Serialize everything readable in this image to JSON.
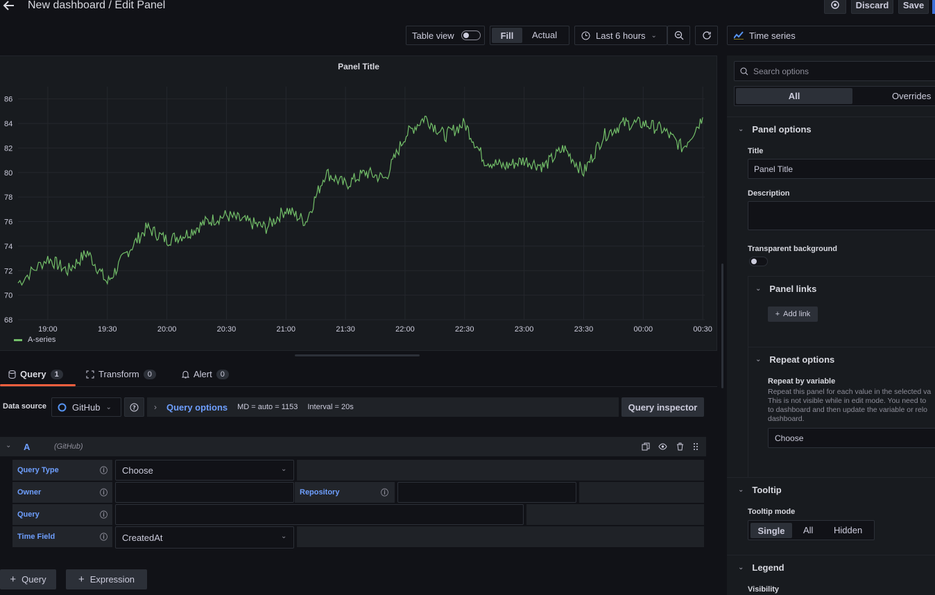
{
  "header": {
    "title": "New dashboard / Edit Panel",
    "discard": "Discard",
    "save": "Save"
  },
  "toolbar": {
    "table_view": "Table view",
    "fill": "Fill",
    "actual": "Actual",
    "time_range": "Last 6 hours",
    "viz_type": "Time series"
  },
  "panel": {
    "title": "Panel Title",
    "chart_data": {
      "type": "line",
      "title": "Panel Title",
      "x_ticks": [
        "19:00",
        "19:30",
        "20:00",
        "20:30",
        "21:00",
        "21:30",
        "22:00",
        "22:30",
        "23:00",
        "23:30",
        "00:00",
        "00:30"
      ],
      "y_ticks": [
        "68",
        "70",
        "72",
        "74",
        "76",
        "78",
        "80",
        "82",
        "84",
        "86"
      ],
      "ylim": [
        68,
        87
      ],
      "series": [
        {
          "name": "A-series",
          "color": "#73bf69",
          "x": [
            "18:45",
            "19:00",
            "19:10",
            "19:20",
            "19:30",
            "19:40",
            "19:50",
            "20:00",
            "20:10",
            "20:20",
            "20:30",
            "20:40",
            "20:50",
            "21:00",
            "21:10",
            "21:20",
            "21:30",
            "21:40",
            "21:50",
            "22:00",
            "22:10",
            "22:20",
            "22:30",
            "22:40",
            "22:50",
            "23:00",
            "23:10",
            "23:20",
            "23:30",
            "23:40",
            "23:50",
            "00:00",
            "00:10",
            "00:20",
            "00:30"
          ],
          "values": [
            71,
            73,
            72,
            73.5,
            71,
            73.5,
            75.5,
            74.5,
            75,
            76,
            76.5,
            76,
            75.5,
            77,
            76,
            80,
            79,
            80,
            79.5,
            83,
            84.5,
            83,
            84,
            81,
            80.5,
            81,
            80.5,
            82,
            80,
            83,
            84,
            84,
            83.5,
            82,
            84.5
          ]
        }
      ]
    }
  },
  "query_tabs": [
    {
      "label": "Query",
      "count": "1"
    },
    {
      "label": "Transform",
      "count": "0"
    },
    {
      "label": "Alert",
      "count": "0"
    }
  ],
  "query": {
    "datasource_label": "Data source",
    "datasource": "GitHub",
    "options_label": "Query options",
    "md": "MD = auto = 1153",
    "interval": "Interval = 20s",
    "inspector": "Query inspector",
    "row_letter": "A",
    "row_ds": "(GitHub)",
    "fields": {
      "query_type": "Query Type",
      "query_type_value": "Choose",
      "owner": "Owner",
      "repository": "Repository",
      "query": "Query",
      "time_field": "Time Field",
      "time_field_value": "CreatedAt"
    },
    "add_query": "Query",
    "add_expression": "Expression"
  },
  "options": {
    "search_placeholder": "Search options",
    "tab_all": "All",
    "tab_overrides": "Overrides",
    "panel_options": "Panel options",
    "title_label": "Title",
    "title_value": "Panel Title",
    "description_label": "Description",
    "transparent_label": "Transparent background",
    "panel_links": "Panel links",
    "add_link": "Add link",
    "repeat_options": "Repeat options",
    "repeat_by": "Repeat by variable",
    "repeat_help": [
      "Repeat this panel for each value in the selected va",
      "This is not visible while in edit mode. You need to",
      "to dashboard and then update the variable or relo",
      "dashboard."
    ],
    "repeat_choose": "Choose",
    "tooltip": "Tooltip",
    "tooltip_mode": "Tooltip mode",
    "tooltip_modes": [
      "Single",
      "All",
      "Hidden"
    ],
    "legend": "Legend",
    "visibility": "Visibility"
  }
}
